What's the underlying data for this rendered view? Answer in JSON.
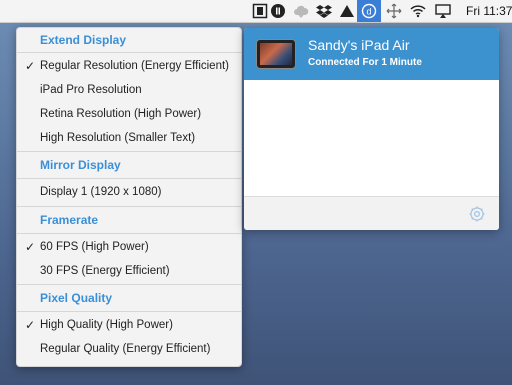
{
  "menubar": {
    "clock": "Fri 11:37",
    "icons": [
      "film-icon",
      "record-icon",
      "cloud-icon",
      "dropbox-icon",
      "warning-triangle-icon",
      "duet-icon",
      "resize-icon",
      "wifi-icon",
      "airplay-icon"
    ],
    "accent": "#3a7fd5"
  },
  "menu": {
    "sections": [
      {
        "header": "Extend Display",
        "items": [
          {
            "label": "Regular Resolution (Energy Efficient)",
            "checked": true
          },
          {
            "label": "iPad Pro Resolution",
            "checked": false
          },
          {
            "label": "Retina Resolution (High Power)",
            "checked": false
          },
          {
            "label": "High Resolution (Smaller Text)",
            "checked": false
          }
        ]
      },
      {
        "header": "Mirror Display",
        "items": [
          {
            "label": "Display 1 (1920 x 1080)",
            "checked": false
          }
        ]
      },
      {
        "header": "Framerate",
        "items": [
          {
            "label": "60 FPS (High Power)",
            "checked": true
          },
          {
            "label": "30 FPS (Energy Efficient)",
            "checked": false
          }
        ]
      },
      {
        "header": "Pixel Quality",
        "items": [
          {
            "label": "High Quality (High Power)",
            "checked": true
          },
          {
            "label": "Regular Quality (Energy Efficient)",
            "checked": false
          }
        ]
      }
    ],
    "check_glyph": "✓",
    "header_color": "#3b8fd8"
  },
  "popover": {
    "device_name": "Sandy's iPad Air",
    "device_status": "Connected For 1 Minute",
    "row_color": "#3c91cf",
    "settings_icon": "gear-icon"
  }
}
